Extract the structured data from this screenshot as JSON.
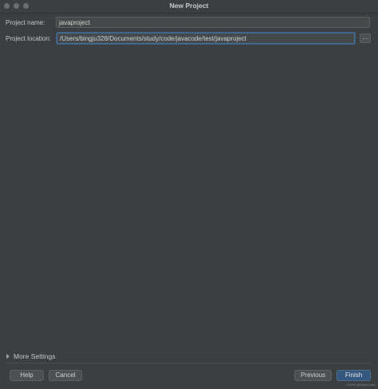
{
  "window": {
    "title": "New Project"
  },
  "form": {
    "project_name_label": "Project name:",
    "project_name_value": "javaproject",
    "project_location_label": "Project location:",
    "project_location_value": "/Users/bingju328/Documents/study/code/javacode/test/javaproject",
    "browse_label": "..."
  },
  "more_settings": {
    "label": "More Settings"
  },
  "buttons": {
    "help": "Help",
    "cancel": "Cancel",
    "previous": "Previous",
    "finish": "Finish"
  },
  "watermark": "CSDN @TodoCoder",
  "colors": {
    "background": "#3c3f41",
    "primary_button": "#365880",
    "focus_border": "#466d94"
  }
}
